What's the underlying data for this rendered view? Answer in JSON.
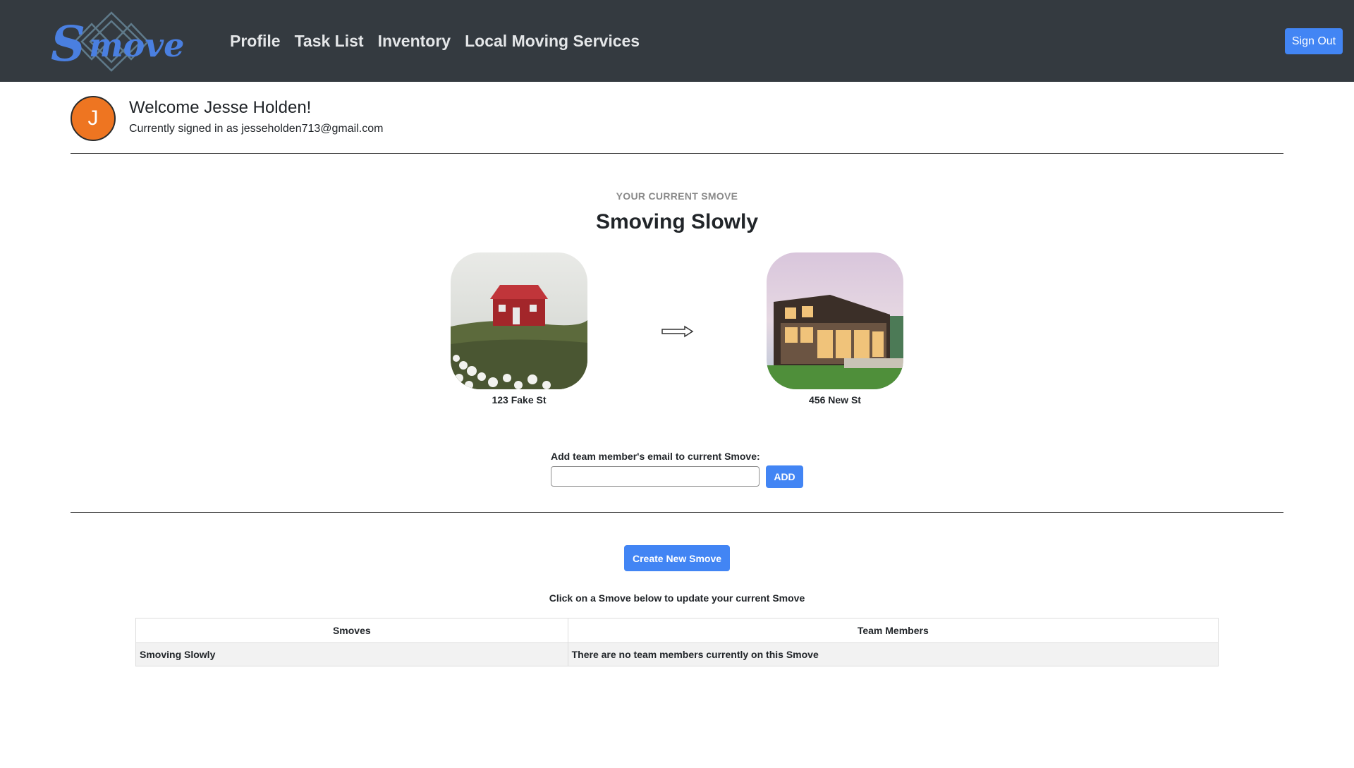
{
  "navbar": {
    "logo_text": "Smove",
    "links": [
      "Profile",
      "Task List",
      "Inventory",
      "Local Moving Services"
    ],
    "signout_label": "Sign Out",
    "bg_color": "#343a40",
    "accent_color": "#4285f4"
  },
  "user": {
    "avatar_initial": "J",
    "avatar_color": "#ee7521",
    "welcome": "Welcome Jesse Holden!",
    "signed_in": "Currently signed in as jesseholden713@gmail.com"
  },
  "current_smove": {
    "eyebrow": "YOUR CURRENT SMOVE",
    "name": "Smoving Slowly",
    "from_address": "123 Fake St",
    "to_address": "456 New St",
    "from_image": "red-cabin-on-hill-photo",
    "to_image": "modern-glass-house-photo",
    "arrow_icon": "right-arrow-icon"
  },
  "team": {
    "add_label": "Add team member's email to current Smove:",
    "email_value": "",
    "add_button": "ADD"
  },
  "actions": {
    "create_button": "Create New Smove",
    "hint": "Click on a Smove below to update your current Smove"
  },
  "table": {
    "headers": [
      "Smoves",
      "Team Members"
    ],
    "rows": [
      [
        "Smoving Slowly",
        "There are no team members currently on this Smove"
      ]
    ]
  }
}
